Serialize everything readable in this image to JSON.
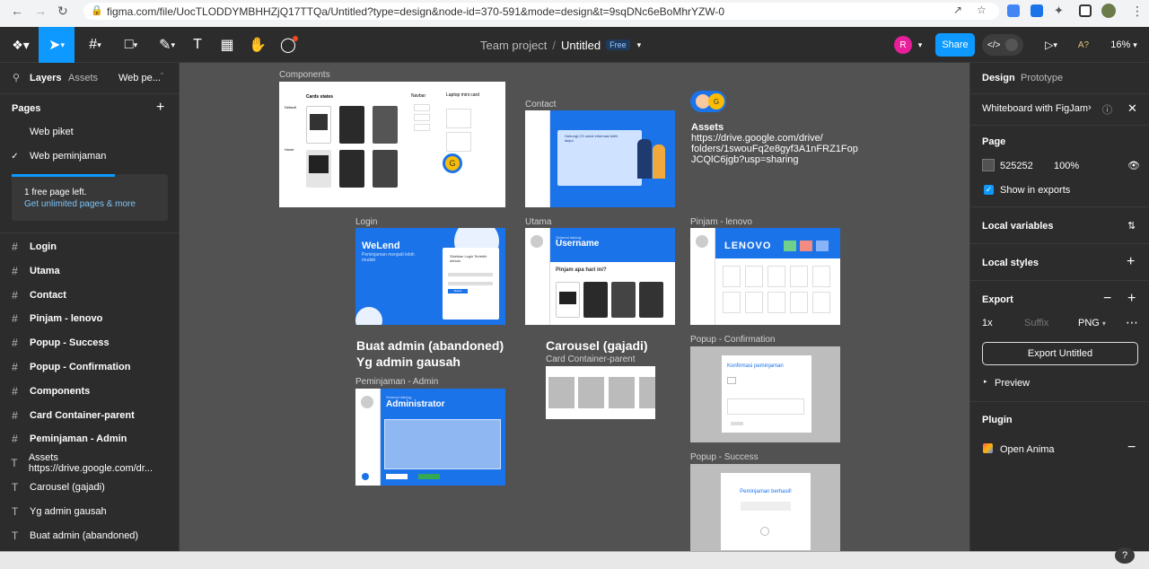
{
  "browser": {
    "url": "figma.com/file/UocTLODDYMBHHZjQ17TTQa/Untitled?type=design&node-id=370-591&mode=design&t=9sqDNc6eBoMhrYZW-0"
  },
  "toolbar": {
    "project": "Team project",
    "separator": "/",
    "file_name": "Untitled",
    "plan_badge": "Free",
    "avatar_initial": "R",
    "share_label": "Share",
    "ai_label": "A?",
    "zoom": "16%",
    "avatar_color": "#e91e9a",
    "accent": "#0d99ff"
  },
  "left_panel": {
    "tabs": [
      "Layers",
      "Assets"
    ],
    "page_dropdown": "Web pe...",
    "pages_title": "Pages",
    "pages": [
      {
        "name": "Web piket",
        "checked": false
      },
      {
        "name": "Web peminjaman",
        "checked": true
      }
    ],
    "upgrade_text": "1 free page left.",
    "upgrade_link": "Get unlimited pages & more",
    "layers": [
      {
        "icon": "#",
        "name": "Login"
      },
      {
        "icon": "#",
        "name": "Utama"
      },
      {
        "icon": "#",
        "name": "Contact"
      },
      {
        "icon": "#",
        "name": "Pinjam - lenovo"
      },
      {
        "icon": "#",
        "name": "Popup - Success"
      },
      {
        "icon": "#",
        "name": "Popup - Confirmation"
      },
      {
        "icon": "#",
        "name": "Components"
      },
      {
        "icon": "#",
        "name": "Card Container-parent"
      },
      {
        "icon": "#",
        "name": "Peminjaman - Admin"
      },
      {
        "icon": "T",
        "name": "Assets https://drive.google.com/dr..."
      },
      {
        "icon": "T",
        "name": "Carousel (gajadi)"
      },
      {
        "icon": "T",
        "name": "Yg admin gausah"
      },
      {
        "icon": "T",
        "name": "Buat admin (abandoned)"
      }
    ]
  },
  "canvas": {
    "background": "#525252",
    "frames": {
      "components": "Components",
      "contact": "Contact",
      "login": "Login",
      "utama": "Utama",
      "pinjam": "Pinjam - lenovo",
      "admin": "Peminjaman - Admin",
      "confirmation": "Popup - Confirmation",
      "success": "Popup - Success",
      "card_container": "Card Container-parent"
    },
    "components_content": {
      "cards_states": "Cards states",
      "default": "Default",
      "hover": "Hover",
      "navbar": "Navbar",
      "laptop_mini": "Laptop mini card"
    },
    "assets_title": "Assets",
    "assets_url": "https://drive.google.com/drive/folders/1swouFq2e8gyf3A1nFRZ1FopJCQlC6jgb?usp=sharing",
    "assets_url_lines": [
      "https://drive.google.com/drive/",
      "folders/1swouFq2e8gyf3A1nFRZ1Fop",
      "JCQlC6jgb?usp=sharing"
    ],
    "buat_admin": "Buat admin (abandoned)",
    "yg_admin": "Yg admin gausah",
    "carousel": "Carousel (gajadi)",
    "login_brand": "WeLend",
    "login_tagline": "Peminjaman menjadi lebih mudah",
    "login_box_title": "Silahkan Login Terlebih dahulu",
    "login_btn": "Masuk",
    "utama_greeting": "Selamat datang,",
    "utama_username": "Username",
    "utama_question": "Pinjam apa hari ini?",
    "lenovo": "LENOVO",
    "admin_greeting": "Selamat datang,",
    "admin_title": "Administrator",
    "contact_heading": "Hubungi CS untuk informasi lebih lanjut",
    "confirm_title": "Konfirmasi peminjaman",
    "success_title": "Peminjaman berhasil!",
    "cursor_initial": "G"
  },
  "right_panel": {
    "tabs": [
      "Design",
      "Prototype"
    ],
    "banner": "Whiteboard with FigJam",
    "page_title": "Page",
    "page_color": "525252",
    "page_opacity": "100%",
    "show_exports": "Show in exports",
    "local_variables": "Local variables",
    "local_styles": "Local styles",
    "export_title": "Export",
    "export_scale": "1x",
    "export_suffix_placeholder": "Suffix",
    "export_format": "PNG",
    "export_button": "Export Untitled",
    "preview": "Preview",
    "plugin_title": "Plugin",
    "plugin_name": "Open Anima"
  }
}
